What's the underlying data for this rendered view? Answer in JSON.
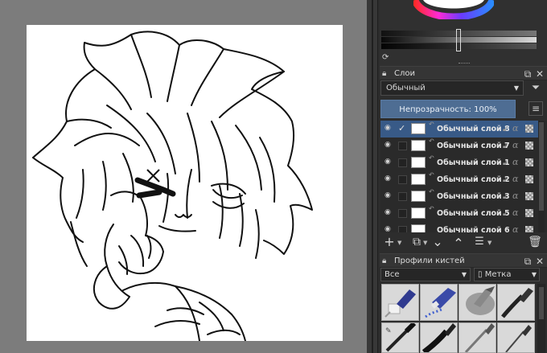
{
  "layers_panel": {
    "title": "Слои",
    "blend_mode": "Обычный",
    "opacity_label": "Непрозрачность:  100%",
    "layers": [
      {
        "name": "Обычный слой 8"
      },
      {
        "name": "Обычный слой 7"
      },
      {
        "name": "Обычный слой 1"
      },
      {
        "name": "Обычный слой 2"
      },
      {
        "name": "Обычный слой 3"
      },
      {
        "name": "Обычный слой 5"
      },
      {
        "name": "Обычный слой 6"
      }
    ]
  },
  "brushes_panel": {
    "title": "Профили кистей",
    "filter_value": "Все",
    "tag_label": "Метка"
  },
  "colors": {
    "accent": "#385a87",
    "opacity_bar": "#5b7fab",
    "panel_bg": "#2d2d2d",
    "canvas_bg": "#7c7c7c"
  },
  "icons": [
    "refresh-icon",
    "lock-icon",
    "filter-icon",
    "hamburger-icon",
    "eye-icon",
    "check-icon",
    "alpha-lock-icon",
    "inherit-alpha-icon",
    "add-icon",
    "duplicate-icon",
    "move-down-icon",
    "move-up-icon",
    "properties-icon",
    "trash-icon",
    "tag-icon",
    "float-icon",
    "close-icon"
  ]
}
